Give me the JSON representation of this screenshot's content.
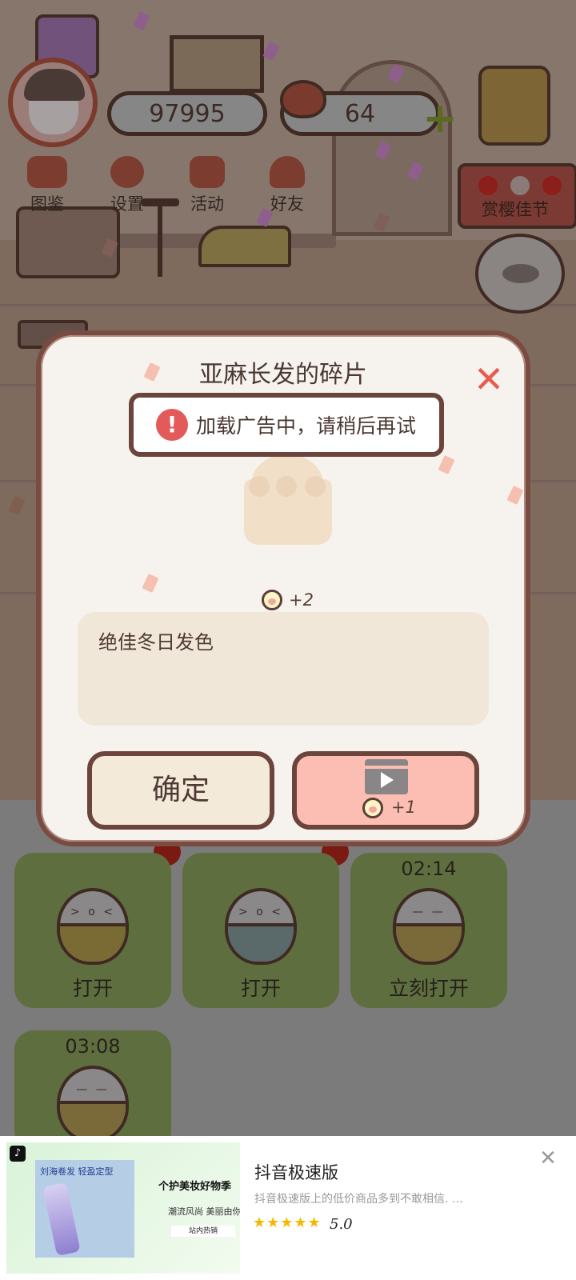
{
  "hud": {
    "coins": "97995",
    "hearts": "64",
    "menu": [
      {
        "label": "图鉴"
      },
      {
        "label": "设置"
      },
      {
        "label": "活动"
      },
      {
        "label": "好友"
      }
    ],
    "festival_label": "赏樱佳节"
  },
  "slots": [
    {
      "timer": "",
      "label": "打开",
      "band_color": "#7a6a34",
      "eyes": "> o <"
    },
    {
      "timer": "",
      "label": "打开",
      "band_color": "#5a6a6a",
      "eyes": "> o <"
    },
    {
      "timer": "02:14",
      "label": "立刻打开",
      "band_color": "#7a6a3a",
      "eyes": "— —"
    },
    {
      "timer": "03:08",
      "label": "",
      "band_color": "#7a6a3a",
      "eyes": "— —"
    }
  ],
  "dialog": {
    "title": "亚麻长发的碎片",
    "toast": "加载广告中，请稍后再试",
    "reward": "+2",
    "description": "绝佳冬日发色",
    "confirm_label": "确定",
    "ad_reward": "+1"
  },
  "ad": {
    "product_text": "刘海卷发 轻盈定型",
    "slogan": "个护美妆好物季",
    "sub": "潮流风尚 美丽由你",
    "tag": "站内热销",
    "title": "抖音极速版",
    "description": "抖音极速版上的低价商品多到不敢相信.  …",
    "stars": "★★★★★",
    "rating": "5.0"
  },
  "colors": {
    "dialog_bg": "#f6f3ee",
    "dialog_border": "#7a4b40",
    "close": "#e85d52",
    "ad_button": "#fcbdb3",
    "confirm_button": "#f4ead9",
    "warn": "#e35a5a",
    "star": "#f5b800"
  }
}
